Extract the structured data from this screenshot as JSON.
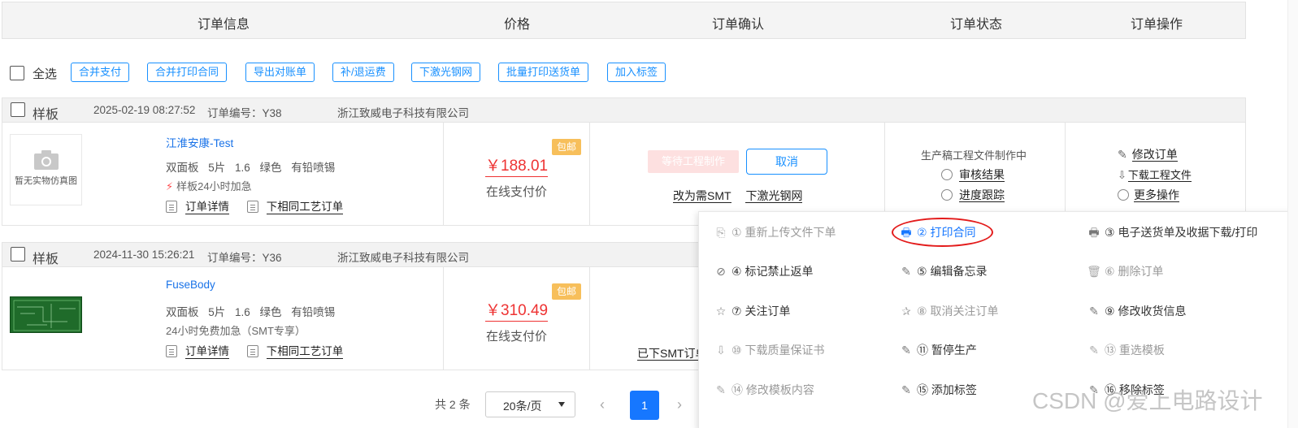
{
  "header": {
    "cols": [
      "订单信息",
      "价格",
      "订单确认",
      "订单状态",
      "订单操作"
    ]
  },
  "toolbar": {
    "select_all": "全选",
    "buttons": [
      "合并支付",
      "合并打印合同",
      "导出对账单",
      "补/退运费",
      "下激光钢网",
      "批量打印送货单",
      "加入标签"
    ]
  },
  "orders": [
    {
      "type": "样板",
      "time": "2025-02-19 08:27:52",
      "order_no": "订单编号：Y38",
      "company": "浙江致威电子科技有限公司",
      "thumb_caption": "暂无实物仿真图",
      "name": "江淮安康-Test",
      "spec": "双面板 5片 1.6 绿色 有铅喷锡",
      "flag": "样板24小时加急",
      "detail_link": "订单详情",
      "same_link": "下相同工艺订单",
      "badge": "包邮",
      "price": "￥188.01",
      "pay_method": "在线支付价",
      "wait_btn": "等待工程制作",
      "cancel_btn": "取消",
      "confirm_links": [
        "改为需SMT",
        "下激光钢网"
      ],
      "status": "生产稿工程文件制作中",
      "status_links": [
        "审核结果",
        "进度跟踪"
      ],
      "ops": [
        "修改订单",
        "下载工程文件",
        "更多操作"
      ]
    },
    {
      "type": "样板",
      "time": "2024-11-30 15:26:21",
      "order_no": "订单编号：Y36",
      "company": "浙江致威电子科技有限公司",
      "name": "FuseBody",
      "spec": "双面板 5片 1.6 绿色 有铅喷锡",
      "flag": "24小时免费加急（SMT专享）",
      "detail_link": "订单详情",
      "same_link": "下相同工艺订单",
      "badge": "包邮",
      "price": "￥310.49",
      "pay_method": "在线支付价",
      "confirm_partial": "已下SMT订单"
    }
  ],
  "menu": {
    "items": [
      {
        "text": "① 重新上传文件下单",
        "icon": "upload-doc-icon",
        "state": "disabled"
      },
      {
        "text": "② 打印合同",
        "icon": "printer-icon",
        "state": "active"
      },
      {
        "text": "③ 电子送货单及收据下载/打印",
        "icon": "printer-icon",
        "state": "normal"
      },
      {
        "text": "④ 标记禁止返单",
        "icon": "ban-icon",
        "state": "normal"
      },
      {
        "text": "⑤ 编辑备忘录",
        "icon": "edit-icon",
        "state": "normal"
      },
      {
        "text": "⑥ 删除订单",
        "icon": "trash-icon",
        "state": "disabled"
      },
      {
        "text": "⑦ 关注订单",
        "icon": "star-icon",
        "state": "normal"
      },
      {
        "text": "⑧ 取消关注订单",
        "icon": "unstar-icon",
        "state": "disabled"
      },
      {
        "text": "⑨ 修改收货信息",
        "icon": "pen-icon",
        "state": "normal"
      },
      {
        "text": "⑩ 下载质量保证书",
        "icon": "download-icon",
        "state": "disabled"
      },
      {
        "text": "⑪ 暂停生产",
        "icon": "edit-icon",
        "state": "normal"
      },
      {
        "text": "⑬ 重选模板",
        "icon": "edit-icon",
        "state": "disabled"
      },
      {
        "text": "⑭ 修改模板内容",
        "icon": "edit-icon",
        "state": "disabled"
      },
      {
        "text": "⑮ 添加标签",
        "icon": "edit-icon",
        "state": "normal"
      },
      {
        "text": "⑯ 移除标签",
        "icon": "edit-icon",
        "state": "normal"
      }
    ]
  },
  "pagination": {
    "total": "共 2 条",
    "page_size": "20条/页",
    "current": "1",
    "prev": "‹",
    "next": "›"
  },
  "watermark": "CSDN @爱上电路设计",
  "colors": {
    "accent": "#1677ff",
    "price": "#e33333",
    "badge": "#f7bf5b",
    "annotation": "#e31b1b"
  }
}
